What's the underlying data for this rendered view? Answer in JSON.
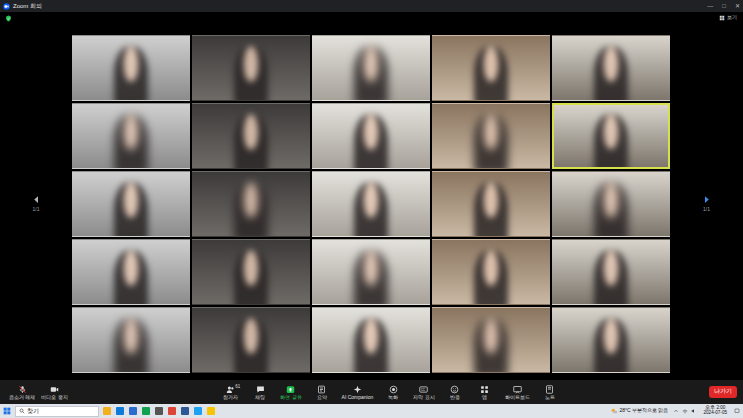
{
  "window": {
    "title": "Zoom 회의",
    "controls": [
      "—",
      "□",
      "✕"
    ],
    "view_button": "보기"
  },
  "gallery": {
    "page_left": "1/1",
    "page_right": "1/1",
    "tiles": [
      {
        "speaking": false
      },
      {
        "speaking": false
      },
      {
        "speaking": false
      },
      {
        "speaking": false
      },
      {
        "speaking": false
      },
      {
        "speaking": false
      },
      {
        "speaking": false
      },
      {
        "speaking": false
      },
      {
        "speaking": false
      },
      {
        "speaking": true
      },
      {
        "speaking": false
      },
      {
        "speaking": false
      },
      {
        "speaking": false
      },
      {
        "speaking": false
      },
      {
        "speaking": false
      },
      {
        "speaking": false
      },
      {
        "speaking": false
      },
      {
        "speaking": false
      },
      {
        "speaking": false
      },
      {
        "speaking": false
      },
      {
        "speaking": false
      },
      {
        "speaking": false
      },
      {
        "speaking": false
      },
      {
        "speaking": false
      },
      {
        "speaking": false
      }
    ]
  },
  "toolbar": {
    "left": [
      {
        "label": "음소거 해제",
        "off": true
      },
      {
        "label": "비디오 중지",
        "off": false
      }
    ],
    "center": [
      {
        "label": "참가자",
        "badge": "61",
        "highlighted": false
      },
      {
        "label": "채팅",
        "badge": "",
        "highlighted": false
      },
      {
        "label": "화면 공유",
        "badge": "",
        "highlighted": true
      },
      {
        "label": "요약",
        "badge": "",
        "highlighted": false
      },
      {
        "label": "AI Companion",
        "badge": "",
        "highlighted": false
      },
      {
        "label": "녹화",
        "badge": "",
        "highlighted": false
      },
      {
        "label": "자막 표시",
        "badge": "",
        "highlighted": false
      },
      {
        "label": "반응",
        "badge": "",
        "highlighted": false
      },
      {
        "label": "앱",
        "badge": "",
        "highlighted": false
      },
      {
        "label": "화이트보드",
        "badge": "",
        "highlighted": false
      },
      {
        "label": "노트",
        "badge": "",
        "highlighted": false
      }
    ],
    "leave": "나가기"
  },
  "taskbar": {
    "search": "찾기",
    "weather": "28°C 부분적으로 맑음",
    "time": "오후 2:00",
    "date": "2024-07-05"
  }
}
